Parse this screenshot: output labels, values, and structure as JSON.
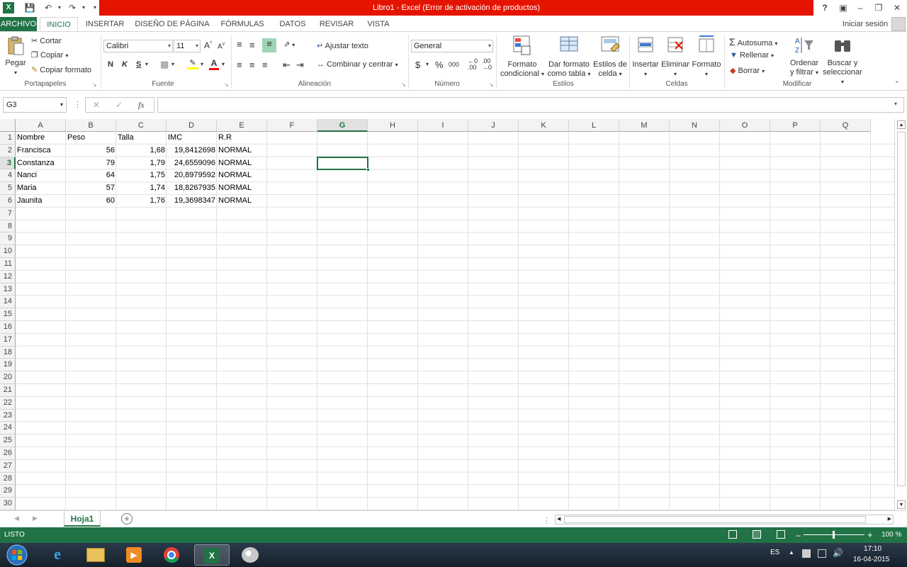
{
  "window": {
    "title": "Libro1 -  Excel (Error de activación de productos)",
    "help": "?",
    "user": "Iniciar sesión"
  },
  "tabs": [
    "ARCHIVO",
    "INICIO",
    "INSERTAR",
    "DISEÑO DE PÁGINA",
    "FÓRMULAS",
    "DATOS",
    "REVISAR",
    "VISTA"
  ],
  "ribbon": {
    "clipboard": {
      "paste": "Pegar",
      "cut": "Cortar",
      "copy": "Copiar",
      "format_painter": "Copiar formato",
      "label": "Portapapeles"
    },
    "font": {
      "name": "Calibri",
      "size": "11",
      "bold": "N",
      "italic": "K",
      "underline": "S",
      "label": "Fuente"
    },
    "alignment": {
      "wrap": "Ajustar texto",
      "merge": "Combinar y centrar",
      "label": "Alineación"
    },
    "number": {
      "format": "General",
      "currency": "$",
      "percent": "%",
      "thousands": "000",
      "label": "Número"
    },
    "styles": {
      "conditional": [
        "Formato",
        "condicional"
      ],
      "as_table": [
        "Dar formato",
        "como tabla"
      ],
      "cell_styles": [
        "Estilos de",
        "celda"
      ],
      "label": "Estilos"
    },
    "cells": {
      "insert": "Insertar",
      "delete": "Eliminar",
      "format": "Formato",
      "label": "Celdas"
    },
    "editing": {
      "autosum": "Autosuma",
      "fill": "Rellenar",
      "clear": "Borrar",
      "sort": [
        "Ordenar",
        "y filtrar"
      ],
      "find": [
        "Buscar y",
        "seleccionar"
      ],
      "label": "Modificar"
    }
  },
  "formula_bar": {
    "name_box": "G3",
    "fx": "fx",
    "value": ""
  },
  "sheet": {
    "columns": [
      "A",
      "B",
      "C",
      "D",
      "E",
      "F",
      "G",
      "H",
      "I",
      "J",
      "K",
      "L",
      "M",
      "N",
      "O",
      "P",
      "Q"
    ],
    "selected_column": "G",
    "selected_row": 3,
    "row_count": 30,
    "rows": [
      [
        "Nombre",
        "Peso",
        "Talla",
        "IMC",
        "R.R"
      ],
      [
        "Francisca",
        "56",
        "1,68",
        "19,8412698",
        "NORMAL"
      ],
      [
        "Constanza",
        "79",
        "1,79",
        "24,6559096",
        "NORMAL"
      ],
      [
        "Nanci",
        "64",
        "1,75",
        "20,8979592",
        "NORMAL"
      ],
      [
        "Maria",
        "57",
        "1,74",
        "18,8267935",
        "NORMAL"
      ],
      [
        "Jaunita",
        "60",
        "1,76",
        "19,3698347",
        "NORMAL"
      ]
    ]
  },
  "sheet_tabs": {
    "active": "Hoja1",
    "add": "+"
  },
  "status": {
    "mode": "LISTO",
    "zoom": "100 %"
  },
  "taskbar": {
    "lang": "ES",
    "time": "17:10",
    "date": "16-04-2015"
  },
  "colors": {
    "excel_green": "#217346",
    "title_red": "#e51400"
  }
}
